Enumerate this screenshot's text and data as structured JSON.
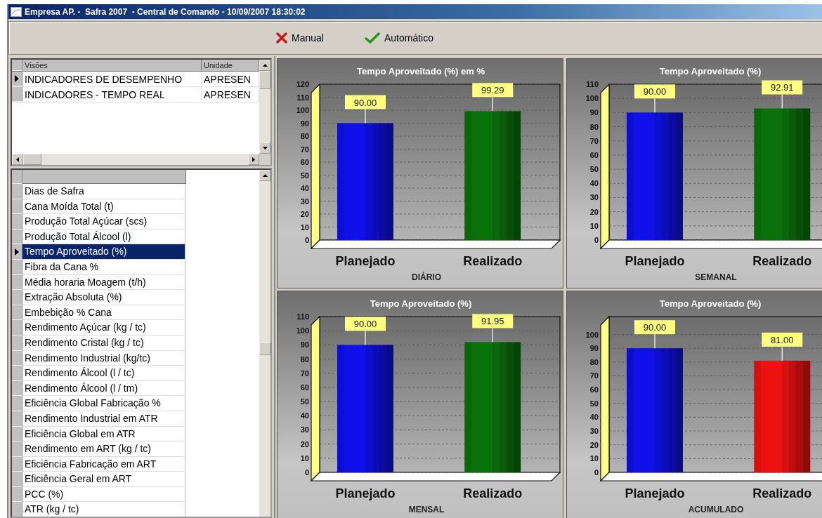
{
  "window": {
    "title": "Empresa AP. -  Safra 2007  - Central de Comando - 10/09/2007 18:30:02"
  },
  "toolbar": {
    "buttons": [
      {
        "kind": "cancel",
        "label": "Manual"
      },
      {
        "kind": "confirm",
        "label": "Automático"
      }
    ]
  },
  "views_grid": {
    "columns": [
      "Visões",
      "Unidade"
    ],
    "rows": [
      {
        "cells": [
          "INDICADORES DE DESEMPENHO",
          "APRESEN"
        ],
        "selected": true
      },
      {
        "cells": [
          "INDICADORES - TEMPO REAL",
          "APRESEN"
        ],
        "selected": false
      }
    ]
  },
  "indicators": {
    "items": [
      {
        "label": "Dias de Safra",
        "selected": false
      },
      {
        "label": "Cana Moída Total (t)",
        "selected": false
      },
      {
        "label": "Produção Total Açúcar (scs)",
        "selected": false
      },
      {
        "label": "Produção Total Álcool (l)",
        "selected": false
      },
      {
        "label": "Tempo Aproveitado (%)",
        "selected": true
      },
      {
        "label": "Fibra da Cana %",
        "selected": false
      },
      {
        "label": "Média horaria Moagem (t/h)",
        "selected": false
      },
      {
        "label": "Extração Absoluta (%)",
        "selected": false
      },
      {
        "label": "Embebição % Cana",
        "selected": false
      },
      {
        "label": "Rendimento Açúcar (kg / tc)",
        "selected": false
      },
      {
        "label": "Rendimento Cristal (kg / tc)",
        "selected": false
      },
      {
        "label": "Rendimento Industrial (kg/tc)",
        "selected": false
      },
      {
        "label": "Rendimento Álcool (l / tc)",
        "selected": false
      },
      {
        "label": "Rendimento Álcool (l / tm)",
        "selected": false
      },
      {
        "label": "Eficiência Global Fabricação %",
        "selected": false
      },
      {
        "label": "Rendimento Industrial em ATR",
        "selected": false
      },
      {
        "label": "Eficiência Global em ATR",
        "selected": false
      },
      {
        "label": "Rendimento em ART (kg / tc)",
        "selected": false
      },
      {
        "label": "Eficiência Fabricação em ART",
        "selected": false
      },
      {
        "label": "Eficiência Geral em ART",
        "selected": false
      },
      {
        "label": "PCC (%)",
        "selected": false
      },
      {
        "label": "ATR (kg / tc)",
        "selected": false
      }
    ]
  },
  "charts": [
    {
      "chart_data": {
        "type": "bar",
        "title": "Tempo Aproveitado (%) em %",
        "xlabel": "DIÁRIO",
        "categories": [
          "Planejado",
          "Realizado"
        ],
        "values": [
          90,
          99.29
        ],
        "colors": [
          "#1010e8",
          "#0b720b"
        ],
        "value_labels": [
          "90.00",
          "99.29"
        ],
        "grid": true,
        "ylim": [
          0,
          120
        ],
        "yticks": [
          0,
          10,
          20,
          30,
          40,
          50,
          60,
          70,
          80,
          90,
          100,
          110,
          120
        ]
      }
    },
    {
      "chart_data": {
        "type": "bar",
        "title": "Tempo Aproveitado (%)",
        "xlabel": "SEMANAL",
        "categories": [
          "Planejado",
          "Realizado"
        ],
        "values": [
          90,
          92.91
        ],
        "colors": [
          "#1010e8",
          "#0b720b"
        ],
        "value_labels": [
          "90.00",
          "92.91"
        ],
        "grid": true,
        "ylim": [
          0,
          110
        ],
        "yticks": [
          0,
          10,
          20,
          30,
          40,
          50,
          60,
          70,
          80,
          90,
          100,
          110
        ]
      }
    },
    {
      "chart_data": {
        "type": "bar",
        "title": "Tempo Aproveitado (%)",
        "xlabel": "MENSAL",
        "categories": [
          "Planejado",
          "Realizado"
        ],
        "values": [
          90,
          91.95
        ],
        "colors": [
          "#1010e8",
          "#0b720b"
        ],
        "value_labels": [
          "90.00",
          "91.95"
        ],
        "grid": true,
        "ylim": [
          0,
          110
        ],
        "yticks": [
          0,
          10,
          20,
          30,
          40,
          50,
          60,
          70,
          80,
          90,
          100,
          110
        ]
      }
    },
    {
      "chart_data": {
        "type": "bar",
        "title": "Tempo Aproveitado (%)",
        "xlabel": "ACUMULADO",
        "categories": [
          "Planejado",
          "Realizado"
        ],
        "values": [
          90,
          81
        ],
        "colors": [
          "#1010e8",
          "#ee1111"
        ],
        "value_labels": [
          "90.00",
          "81.00"
        ],
        "grid": true,
        "ylim": [
          0,
          113
        ],
        "yticks": [
          0,
          10,
          20,
          30,
          40,
          50,
          60,
          70,
          80,
          90,
          100
        ]
      }
    }
  ]
}
